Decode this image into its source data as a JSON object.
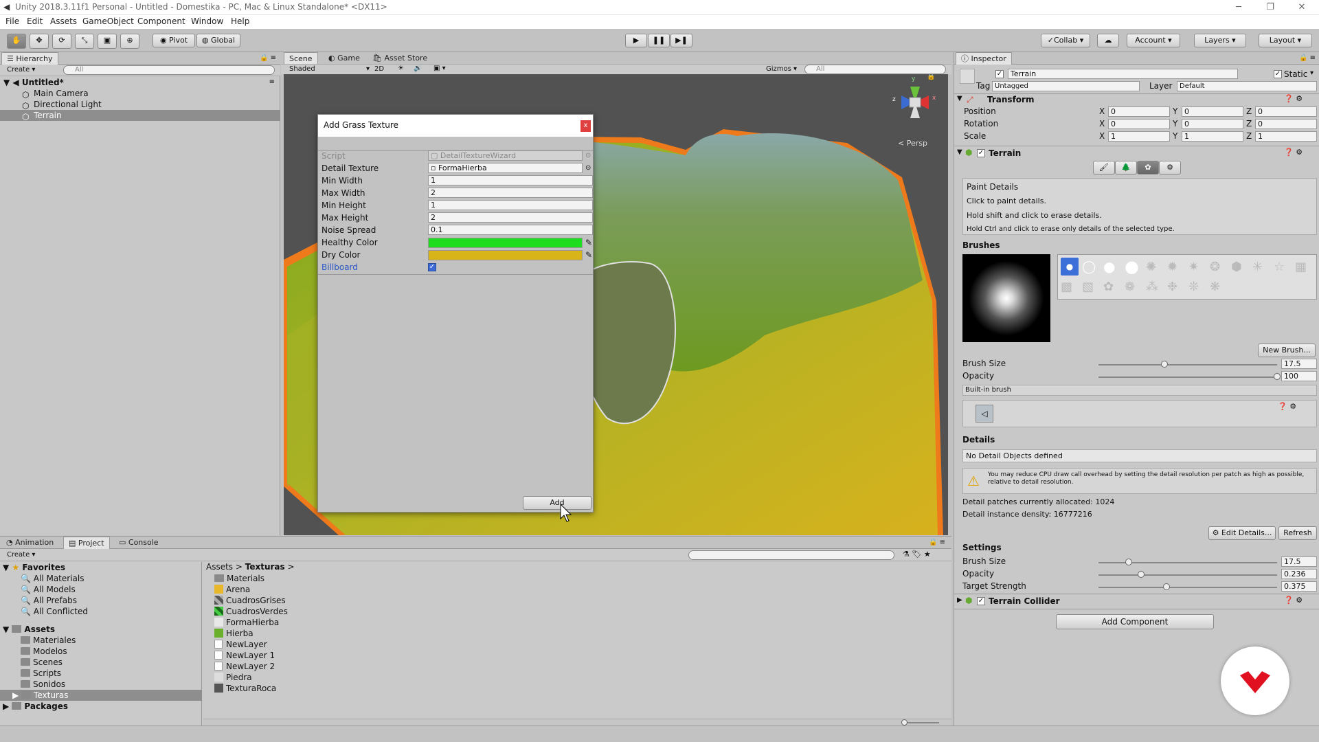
{
  "window": {
    "title": "Unity 2018.3.11f1 Personal - Untitled - Domestika - PC, Mac & Linux Standalone* <DX11>",
    "minimize": "─",
    "maximize": "❐",
    "close": "✕"
  },
  "menu": [
    "File",
    "Edit",
    "Assets",
    "GameObject",
    "Component",
    "Window",
    "Help"
  ],
  "toolbar": {
    "pivot": "Pivot",
    "global": "Global",
    "collab": "Collab",
    "account": "Account",
    "layers": "Layers",
    "layout": "Layout"
  },
  "hierarchy": {
    "tab": "Hierarchy",
    "create": "Create",
    "search_placeholder": "All",
    "scene": "Untitled*",
    "items": [
      "Main Camera",
      "Directional Light",
      "Terrain"
    ]
  },
  "scene_view": {
    "tabs": [
      "Scene",
      "Game",
      "Asset Store"
    ],
    "shading": "Shaded",
    "mode_2d": "2D",
    "gizmos": "Gizmos",
    "search_placeholder": "All",
    "persp": "Persp",
    "gizmo_y": "y",
    "gizmo_z": "z",
    "gizmo_x": "x"
  },
  "dialog": {
    "title": "Add Grass Texture",
    "close": "x",
    "rows": [
      {
        "label": "Script",
        "value": "DetailTextureWizard"
      },
      {
        "label": "Detail Texture",
        "value": "FormaHierba"
      },
      {
        "label": "Min Width",
        "value": "1"
      },
      {
        "label": "Max Width",
        "value": "2"
      },
      {
        "label": "Min Height",
        "value": "1"
      },
      {
        "label": "Max Height",
        "value": "2"
      },
      {
        "label": "Noise Spread",
        "value": "0.1"
      }
    ],
    "healthy_color_label": "Healthy Color",
    "healthy_color": "#1edc1e",
    "dry_color_label": "Dry Color",
    "dry_color": "#d8b418",
    "billboard_label": "Billboard",
    "add": "Add"
  },
  "inspector": {
    "tab": "Inspector",
    "object_name": "Terrain",
    "static": "Static",
    "tag_label": "Tag",
    "tag": "Untagged",
    "layer_label": "Layer",
    "layer": "Default",
    "transform": {
      "title": "Transform",
      "rows": [
        {
          "label": "Position",
          "x": "0",
          "y": "0",
          "z": "0"
        },
        {
          "label": "Rotation",
          "x": "0",
          "y": "0",
          "z": "0"
        },
        {
          "label": "Scale",
          "x": "1",
          "y": "1",
          "z": "1"
        }
      ]
    },
    "terrain": {
      "title": "Terrain",
      "paint_title": "Paint Details",
      "help": [
        "Click to paint details.",
        "Hold shift and click to erase details.",
        "Hold Ctrl and click to erase only details of the selected type."
      ],
      "brushes": "Brushes",
      "new_brush": "New Brush...",
      "brush_size_label": "Brush Size",
      "brush_size": "17.5",
      "brush_size_level": 0.37,
      "opacity_label": "Opacity",
      "opacity": "100",
      "opacity_level": 1.0,
      "builtin": "Built-in brush",
      "details": "Details",
      "no_details": "No Detail Objects defined",
      "warning": "You may reduce CPU draw call overhead by setting the detail resolution per patch as high as possible, relative to detail resolution.",
      "patches": "Detail patches currently allocated: 1024",
      "density": "Detail instance density: 16777216",
      "edit_details": "Edit Details...",
      "refresh": "Refresh",
      "settings": "Settings",
      "s_brush_size_label": "Brush Size",
      "s_brush_size": "17.5",
      "s_brush_size_level": 0.17,
      "s_opacity_label": "Opacity",
      "s_opacity": "0.236",
      "s_opacity_level": 0.24,
      "s_target_label": "Target Strength",
      "s_target": "0.375",
      "s_target_level": 0.38
    },
    "terrain_collider": "Terrain Collider",
    "add_component": "Add Component"
  },
  "bottom": {
    "tabs": [
      "Animation",
      "Project",
      "Console"
    ],
    "create": "Create",
    "favorites_label": "Favorites",
    "favorites": [
      "All Materials",
      "All Models",
      "All Prefabs",
      "All Conflicted"
    ],
    "assets_label": "Assets",
    "asset_folders": [
      "Materiales",
      "Modelos",
      "Scenes",
      "Scripts",
      "Sonidos",
      "Texturas"
    ],
    "packages": "Packages",
    "breadcrumb": [
      "Assets",
      "Texturas"
    ],
    "files": [
      {
        "name": "Materials",
        "kind": "folder"
      },
      {
        "name": "Arena",
        "kind": "tex-yellow"
      },
      {
        "name": "CuadrosGrises",
        "kind": "tex-grey"
      },
      {
        "name": "CuadrosVerdes",
        "kind": "tex-green"
      },
      {
        "name": "FormaHierba",
        "kind": "tex-white"
      },
      {
        "name": "Hierba",
        "kind": "tex-grass"
      },
      {
        "name": "NewLayer",
        "kind": "doc"
      },
      {
        "name": "NewLayer 1",
        "kind": "doc"
      },
      {
        "name": "NewLayer 2",
        "kind": "doc"
      },
      {
        "name": "Piedra",
        "kind": "tex-white"
      },
      {
        "name": "TexturaRoca",
        "kind": "tex-rock"
      }
    ]
  }
}
